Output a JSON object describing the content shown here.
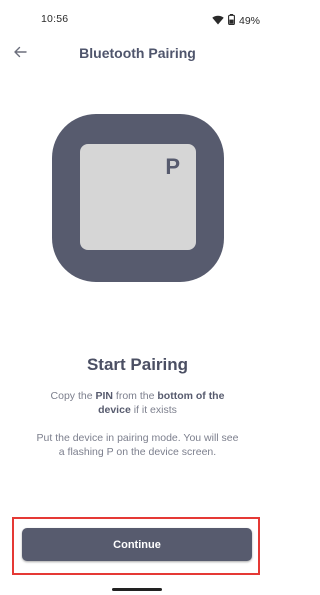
{
  "status_bar": {
    "time": "10:56",
    "battery": "49%",
    "icons": [
      "wifi-icon",
      "battery-icon"
    ]
  },
  "header": {
    "title": "Bluetooth Pairing",
    "back_icon": "arrow-left-icon"
  },
  "illustration": {
    "device_letter": "P"
  },
  "content": {
    "title": "Start Pairing",
    "instruction_1": {
      "pre": "Copy the ",
      "bold1": "PIN",
      "mid": " from the ",
      "bold2": "bottom of the device",
      "post": " if it exists"
    },
    "instruction_2": "Put the device in pairing mode. You will see a flashing P on the device screen."
  },
  "actions": {
    "continue_label": "Continue"
  },
  "colors": {
    "primary": "#575b6e",
    "title": "#4f556c",
    "body_text": "#7c7f8d",
    "device_screen": "#d6d6d6",
    "highlight": "#e53935"
  }
}
